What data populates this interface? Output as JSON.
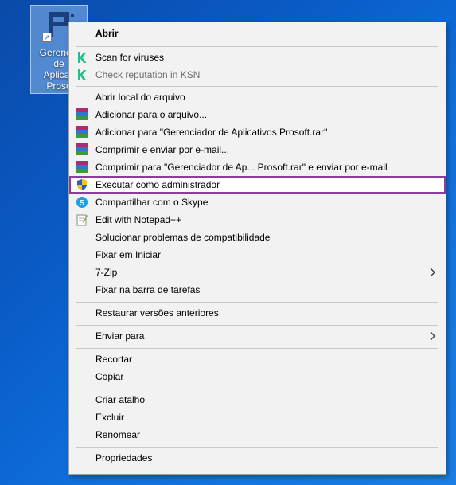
{
  "desktop": {
    "icon_label": "Gerenciador de Aplicativos Prosoft",
    "icon_label_lines": [
      "Gerencia",
      "de",
      "Aplicati",
      "Proso"
    ]
  },
  "menu": {
    "items": [
      {
        "label": "Abrir"
      },
      {
        "label": "Scan for viruses"
      },
      {
        "label": "Check reputation in KSN"
      },
      {
        "label": "Abrir local do arquivo"
      },
      {
        "label": "Adicionar para o arquivo..."
      },
      {
        "label": "Adicionar para \"Gerenciador de Aplicativos Prosoft.rar\""
      },
      {
        "label": "Comprimir e enviar por e-mail..."
      },
      {
        "label": "Comprimir para \"Gerenciador de Ap... Prosoft.rar\" e enviar por e-mail"
      },
      {
        "label": "Executar como administrador"
      },
      {
        "label": "Compartilhar com o Skype"
      },
      {
        "label": "Edit with Notepad++"
      },
      {
        "label": "Solucionar problemas de compatibilidade"
      },
      {
        "label": "Fixar em Iniciar"
      },
      {
        "label": "7-Zip"
      },
      {
        "label": "Fixar na barra de tarefas"
      },
      {
        "label": "Restaurar versões anteriores"
      },
      {
        "label": "Enviar para"
      },
      {
        "label": "Recortar"
      },
      {
        "label": "Copiar"
      },
      {
        "label": "Criar atalho"
      },
      {
        "label": "Excluir"
      },
      {
        "label": "Renomear"
      },
      {
        "label": "Propriedades"
      }
    ]
  },
  "colors": {
    "desktop_bg": "#0a5cc8",
    "menu_bg": "#f2f2f2",
    "highlight_border": "#8b3c9c",
    "kaspersky_green": "#1fbf8f",
    "disabled_text": "#6d6d6d"
  }
}
